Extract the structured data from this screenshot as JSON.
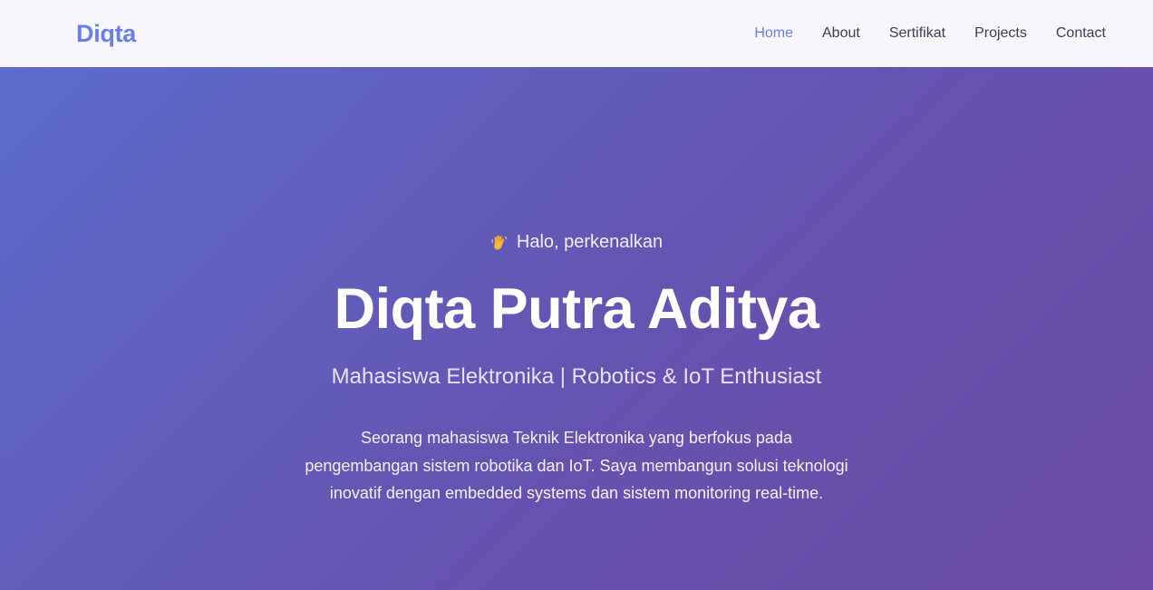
{
  "navbar": {
    "brand": "Diqta",
    "links": [
      {
        "label": "Home",
        "active": true
      },
      {
        "label": "About",
        "active": false
      },
      {
        "label": "Sertifikat",
        "active": false
      },
      {
        "label": "Projects",
        "active": false
      },
      {
        "label": "Contact",
        "active": false
      }
    ]
  },
  "hero": {
    "greeting_icon": "waving-hand-icon",
    "greeting": "Halo, perkenalkan",
    "name": "Diqta Putra Aditya",
    "subtitle": "Mahasiswa Elektronika | Robotics & IoT Enthusiast",
    "description": "Seorang mahasiswa Teknik Elektronika yang berfokus pada pengembangan sistem robotika dan IoT. Saya membangun solusi teknologi inovatif dengan embedded systems dan sistem monitoring real-time."
  },
  "colors": {
    "accent": "#667eea",
    "gradient_start": "#5c6ccb",
    "gradient_end": "#6a4aa3"
  }
}
